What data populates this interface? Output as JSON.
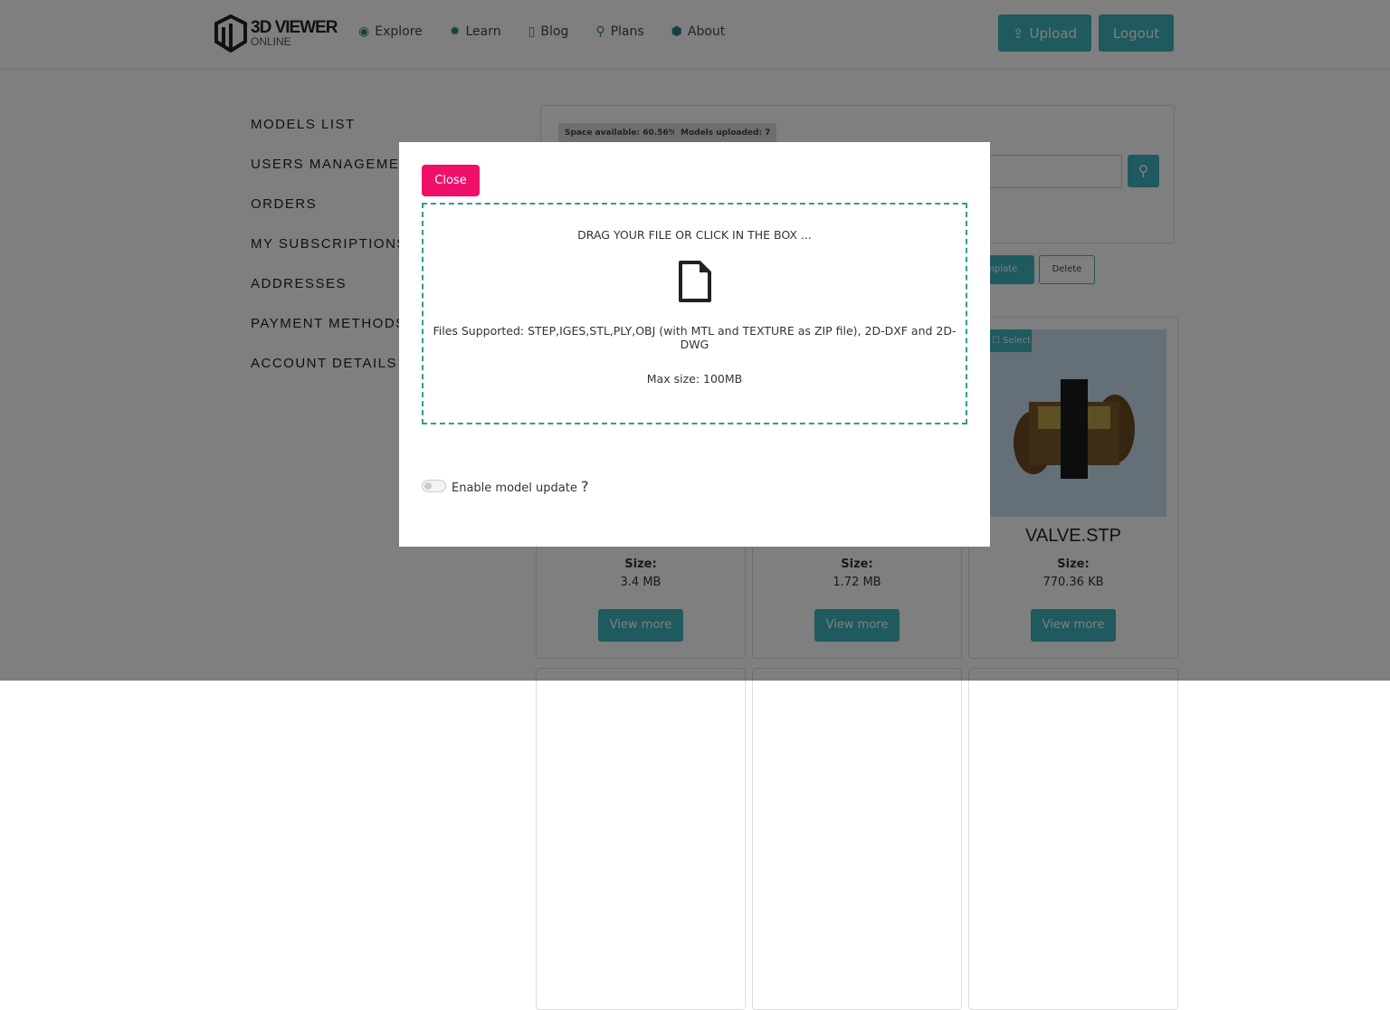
{
  "header": {
    "logo_line1": "3D VIEWER",
    "logo_line2": "ONLINE",
    "nav": [
      {
        "label": "Explore",
        "icon": "compass-icon"
      },
      {
        "label": "Learn",
        "icon": "gear-icon"
      },
      {
        "label": "Blog",
        "icon": "bookmark-icon"
      },
      {
        "label": "Plans",
        "icon": "search-icon"
      },
      {
        "label": "About",
        "icon": "cube-icon"
      }
    ],
    "upload": "Upload",
    "logout": "Logout"
  },
  "sidebar": [
    "MODELS LIST",
    "USERS MANAGEMENT",
    "ORDERS",
    "MY SUBSCRIPTIONS",
    "ADDRESSES",
    "PAYMENT METHODS",
    "ACCOUNT DETAILS"
  ],
  "stats": {
    "space": "Space available: 60.56%",
    "models": "Models uploaded: 7"
  },
  "actions": {
    "template": "Template",
    "delete": "Delete"
  },
  "cards": [
    {
      "name": "",
      "size_label": "Size:",
      "size": "3.4 MB",
      "btn": "View more"
    },
    {
      "name": "",
      "size_label": "Size:",
      "size": "1.72 MB",
      "btn": "View more"
    },
    {
      "name": "VALVE.STP",
      "size_label": "Size:",
      "size": "770.36 KB",
      "btn": "View more",
      "select": "Select"
    }
  ],
  "modal": {
    "close": "Close",
    "drag": "DRAG YOUR FILE OR CLICK IN THE BOX ...",
    "supported": "Files Supported: STEP,IGES,STL,PLY,OBJ (with MTL and TEXTURE as ZIP file), 2D-DXF and 2D-DWG",
    "max": "Max size: 100MB",
    "toggle_label": "Enable model update",
    "help": "?",
    "toggle_on": false
  },
  "colors": {
    "accent": "#3cb4bc",
    "close": "#f0106c",
    "dashed": "#2f9d92"
  }
}
